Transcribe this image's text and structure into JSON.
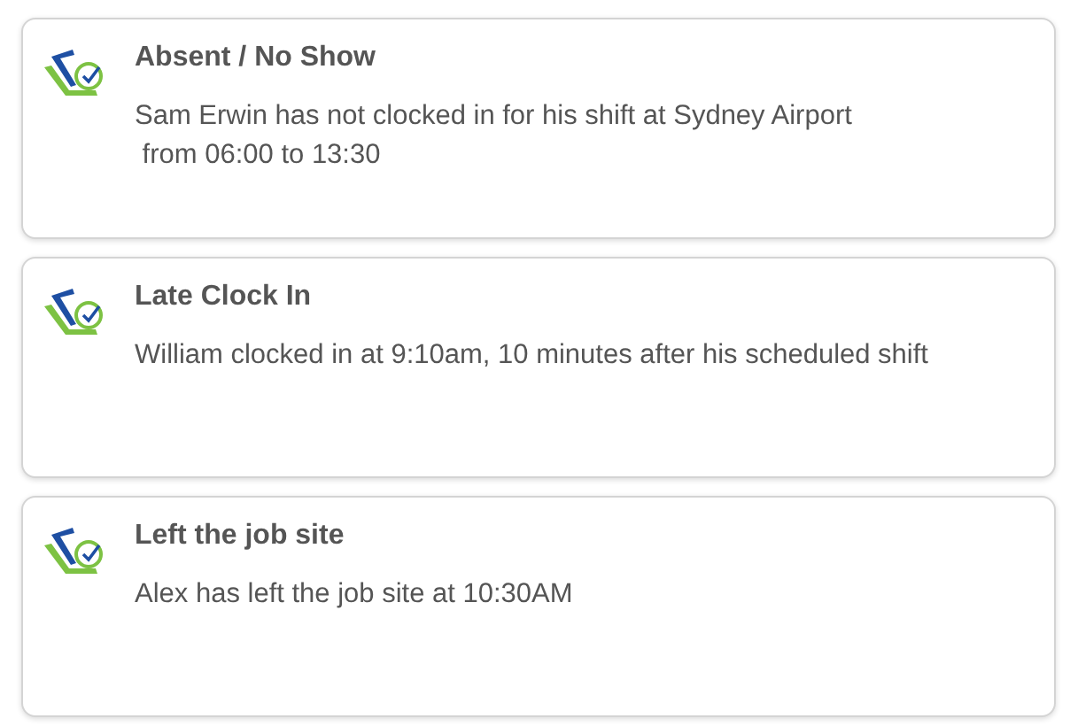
{
  "notifications": [
    {
      "title": "Absent / No Show",
      "lines": [
        "Sam Erwin has not clocked in for his shift at Sydney Airport",
        " from 06:00 to 13:30"
      ]
    },
    {
      "title": "Late Clock In",
      "lines": [
        "William clocked in at 9:10am, 10 minutes after his scheduled shift"
      ]
    },
    {
      "title": "Left the job site",
      "lines": [
        "Alex has left the job site at 10:30AM"
      ]
    }
  ]
}
